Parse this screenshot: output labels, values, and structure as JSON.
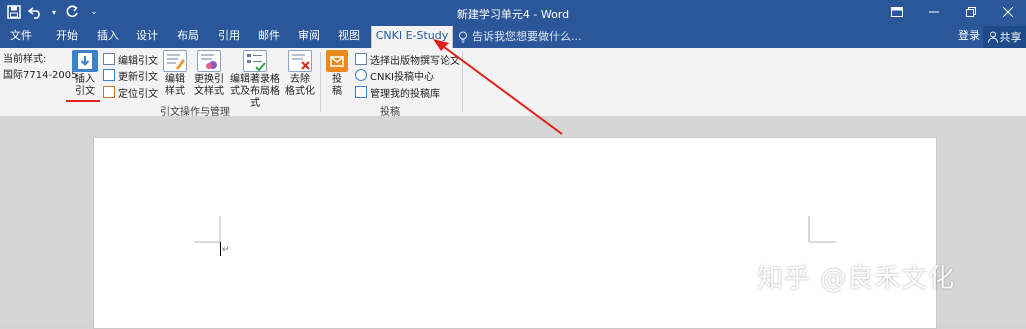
{
  "window": {
    "title": "新建学习单元4 - Word"
  },
  "quick_access": {
    "save_icon": "save-icon",
    "undo_icon": "undo-icon",
    "redo_icon": "redo-icon",
    "customize_icon": "customize-icon"
  },
  "tabs": [
    {
      "label": "文件"
    },
    {
      "label": "开始"
    },
    {
      "label": "插入"
    },
    {
      "label": "设计"
    },
    {
      "label": "布局"
    },
    {
      "label": "引用"
    },
    {
      "label": "邮件"
    },
    {
      "label": "审阅"
    },
    {
      "label": "视图"
    },
    {
      "label": "CNKI E-Study"
    }
  ],
  "tell_me": "告诉我您想要做什么...",
  "account": {
    "login": "登录",
    "share": "共享"
  },
  "ribbon": {
    "current_style_label": "当前样式:",
    "current_style_value": "国际7714-2005",
    "insert_citation": [
      "插入",
      "引文"
    ],
    "edit_citation": "编辑引文",
    "update_citation": "更新引文",
    "locate_citation": "定位引文",
    "edit_style": [
      "编辑",
      "样式"
    ],
    "change_style": [
      "更换引",
      "文样式"
    ],
    "edit_bibliography": [
      "编辑著录格",
      "式及布局格式"
    ],
    "remove_format": [
      "去除",
      "格式化"
    ],
    "group1_label": "引文操作与管理",
    "submit": [
      "投",
      "稿"
    ],
    "select_journal": "选择出版物撰写论文",
    "cnki_center": "CNKI投稿中心",
    "manage_submissions": "管理我的投稿库",
    "group2_label": "投稿"
  },
  "watermark": "知乎 @良禾文化",
  "colors": {
    "title_bar": "#2b579a",
    "ribbon": "#f3f3f3",
    "annotation": "#e0201a"
  }
}
